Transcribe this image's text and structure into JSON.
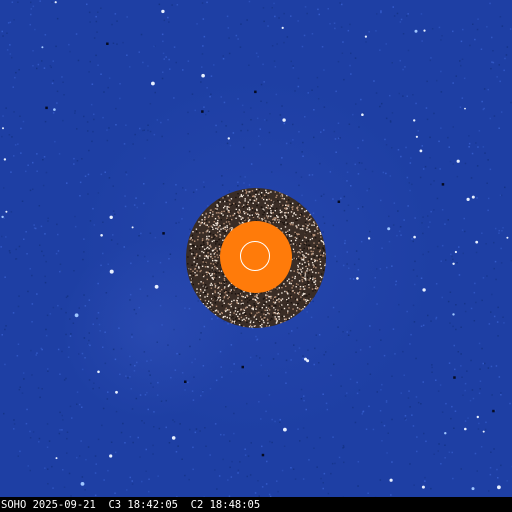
{
  "image": {
    "caption": "SOHO 2025-09-21  C3 18:42:05  C2 18:48:05"
  },
  "colors": {
    "background": "#1e3fa4",
    "inner_field": "#3a2d26",
    "occulter": "#ff7b0a",
    "sun_outline": "#ffffff",
    "caption_text": "#ffffff",
    "caption_bar": "#000000"
  }
}
